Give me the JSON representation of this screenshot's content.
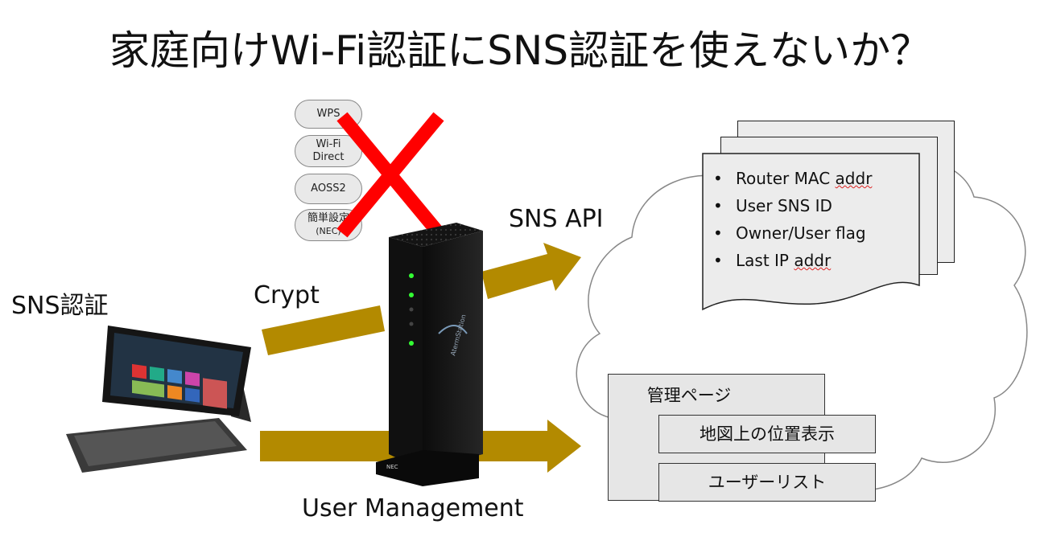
{
  "title": "家庭向けWi-Fi認証にSNS認証を使えないか？",
  "labels": {
    "sns_auth": "SNS認証",
    "crypt": "Crypt",
    "sns_api": "SNS API",
    "user_management": "User Management"
  },
  "setup_methods": [
    {
      "line1": "WPS",
      "line2": ""
    },
    {
      "line1": "Wi-Fi",
      "line2": "Direct"
    },
    {
      "line1": "AOSS2",
      "line2": ""
    },
    {
      "line1": "簡単設定",
      "line2": "(NEC)"
    }
  ],
  "cloud_record": {
    "items": [
      "Router MAC addr",
      "User SNS ID",
      "Owner/User flag",
      "Last IP addr"
    ],
    "squiggly": [
      "addr",
      "",
      "",
      "addr"
    ]
  },
  "admin": {
    "page_title": "管理ページ",
    "map_display": "地図上の位置表示",
    "user_list": "ユーザーリスト"
  },
  "device": {
    "router_brand": "NEC",
    "router_logo": "AtermStation"
  },
  "colors": {
    "arrow": "#b38a00",
    "cross": "#ff0000"
  }
}
